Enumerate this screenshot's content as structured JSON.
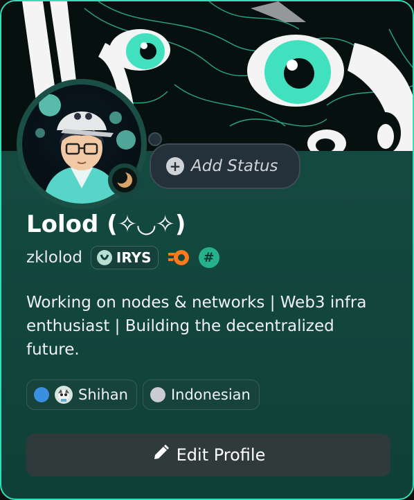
{
  "profile": {
    "display_name": "Lolod (✧◡✧)",
    "username": "zklolod",
    "guild_tag": "IRYS",
    "hash_badge": "#",
    "bio": "Working on nodes & networks | Web3 infra enthusiast | Building the decentralized future.",
    "status_button_label": "Add Status",
    "edit_button_label": "Edit Profile"
  },
  "chips": [
    {
      "label": "Shihan",
      "dot_color": "#3b8fe0",
      "icon": "shihan-avatar-icon"
    },
    {
      "label": "Indonesian",
      "dot_color": "#c9ccd1",
      "icon": ""
    }
  ],
  "colors": {
    "border_accent": "#2fe0b8",
    "card_bg": "#174c43",
    "banner_bg": "#06110f",
    "button_bg": "#2f3a3b"
  },
  "icons": {
    "status": "moon-icon",
    "add_status": "plus-circle-icon",
    "edit": "pencil-icon",
    "boost_badge": "nitro-boost-icon",
    "hash_badge": "hash-badge-icon",
    "guild_logo": "irys-logo-icon"
  }
}
